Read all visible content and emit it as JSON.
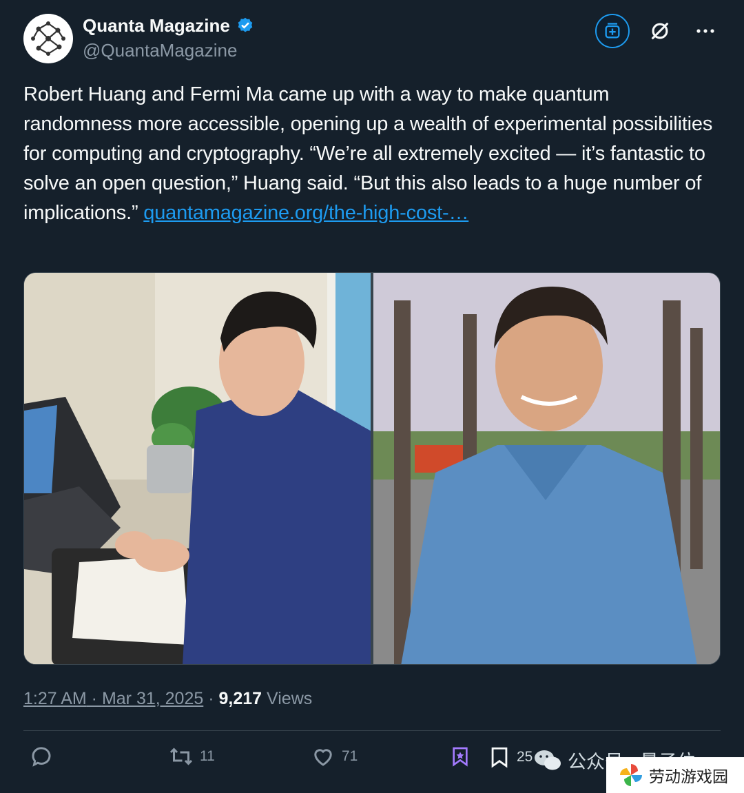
{
  "author": {
    "name": "Quanta Magazine",
    "handle": "@QuantaMagazine"
  },
  "tweet": {
    "text": "Robert Huang and Fermi Ma came up with a way to make quantum randomness more accessible, opening up a wealth of experimental possibilities for computing and cryptography. “We’re all extremely excited — it’s fantastic to solve an open question,” Huang said. “But this also leads to a huge number of implications.” ",
    "link": "quantamagazine.org/the-high-cost-…"
  },
  "meta": {
    "time": "1:27 AM",
    "separator": " · ",
    "date": "Mar 31, 2025",
    "views_count": "9,217",
    "views_label": " Views"
  },
  "actions": {
    "reply_icon": "reply-icon",
    "retweet_count": "11",
    "like_count": "71",
    "bookmark_count": "25"
  },
  "overlay": {
    "wechat_text": "公众号 · 量子位",
    "watermark_text": "劳动游戏园"
  },
  "colors": {
    "background": "#15202b",
    "accent": "#1d9bf0",
    "muted": "#8b98a5",
    "text": "#f7f9f9"
  }
}
